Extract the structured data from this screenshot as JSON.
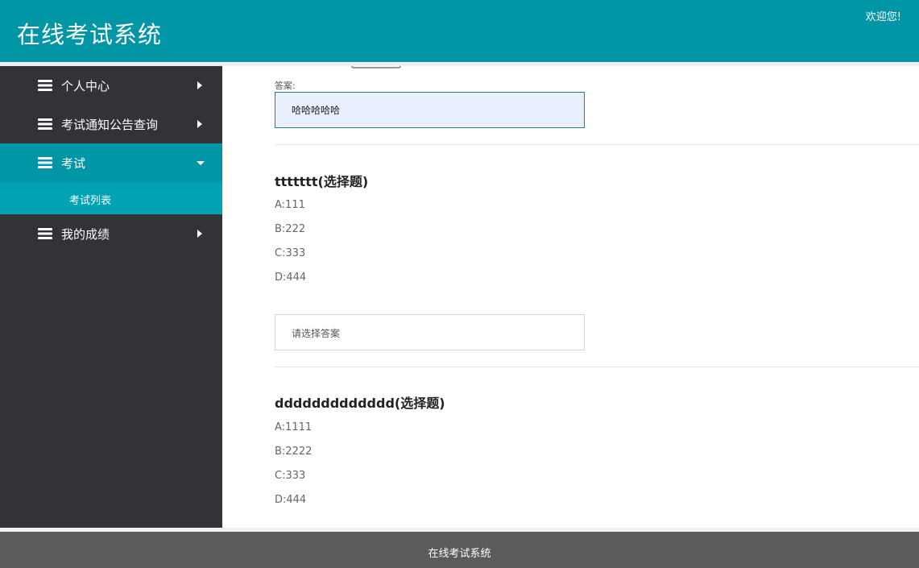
{
  "header": {
    "title": "在线考试系统",
    "welcome": "欢迎您!"
  },
  "sidebar": {
    "items": [
      {
        "label": "个人中心",
        "icon": "layers-icon",
        "arrow": "chevron-right-icon"
      },
      {
        "label": "考试通知公告查询",
        "icon": "layers-icon",
        "arrow": "chevron-right-icon"
      },
      {
        "label": "考试",
        "icon": "layers-icon",
        "arrow": "caret-down-icon",
        "active": true,
        "children": [
          {
            "label": "考试列表"
          }
        ]
      },
      {
        "label": "我的成绩",
        "icon": "layers-icon",
        "arrow": "chevron-right-icon"
      }
    ]
  },
  "main": {
    "answer_label": "答案:",
    "answer_value": "哈哈哈哈哈",
    "questions": [
      {
        "title": "ttttttt(选择题)",
        "options": [
          "A:111",
          "B:222",
          "C:333",
          "D:444"
        ],
        "select_placeholder": "请选择答案"
      },
      {
        "title": "ddddddddddddd(选择题)",
        "options": [
          "A:1111",
          "B:2222",
          "C:333",
          "D:444"
        ]
      }
    ]
  },
  "footer": {
    "text": "在线考试系统"
  },
  "colors": {
    "header_bg": "#0096a5",
    "sidebar_bg": "#323338",
    "active_bg": "#0096a5",
    "submenu_bg": "#00a3b3",
    "footer_bg": "#5b5b5b"
  }
}
